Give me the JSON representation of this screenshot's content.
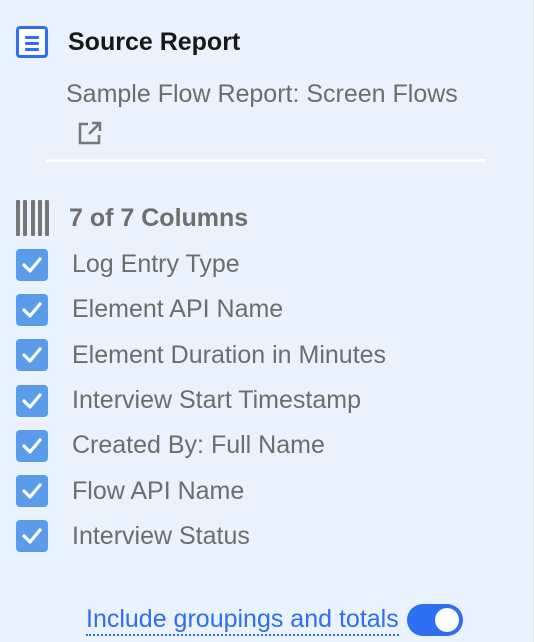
{
  "source_report": {
    "heading": "Source Report",
    "report_name": "Sample Flow Report: Screen Flows",
    "icon": "document-icon",
    "link_icon": "external-link-icon"
  },
  "columns": {
    "heading": "7 of 7 Columns",
    "icon": "columns-icon",
    "items": [
      {
        "label": "Log Entry Type",
        "checked": true
      },
      {
        "label": "Element API Name",
        "checked": true
      },
      {
        "label": "Element Duration in Minutes",
        "checked": true
      },
      {
        "label": "Interview Start Timestamp",
        "checked": true
      },
      {
        "label": "Created By: Full Name",
        "checked": true
      },
      {
        "label": "Flow API Name",
        "checked": true
      },
      {
        "label": "Interview Status",
        "checked": true
      }
    ]
  },
  "groupings": {
    "label": "Include groupings and totals",
    "enabled": true
  },
  "colors": {
    "accent": "#2e6ef0",
    "checkbox": "#5a9cea",
    "background": "#e9f2fd"
  }
}
